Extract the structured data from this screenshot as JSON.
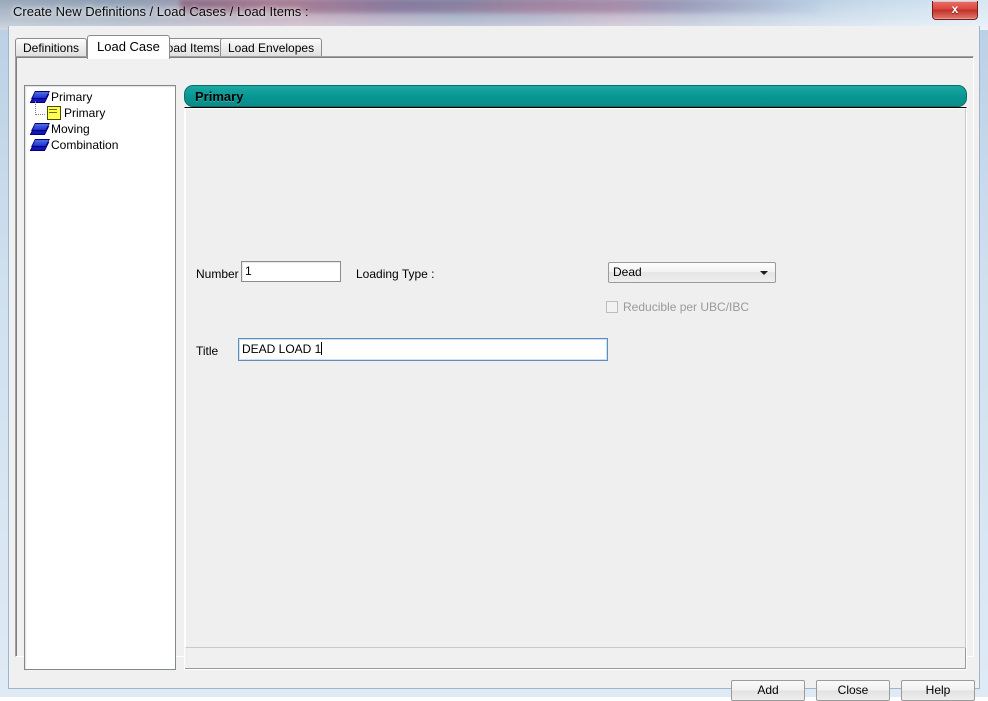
{
  "window": {
    "title": "Create New Definitions / Load Cases / Load Items :",
    "close_label": "x"
  },
  "tabs": [
    {
      "label": "Definitions",
      "active": false
    },
    {
      "label": "Load Case",
      "active": true
    },
    {
      "label": "Load Items",
      "active": false
    },
    {
      "label": "Load Envelopes",
      "active": false
    }
  ],
  "tree": {
    "items": [
      {
        "label": "Primary",
        "icon": "book-icon",
        "level": 0
      },
      {
        "label": "Primary",
        "icon": "note-icon",
        "level": 1
      },
      {
        "label": "Moving",
        "icon": "book-icon",
        "level": 0
      },
      {
        "label": "Combination",
        "icon": "book-icon",
        "level": 0
      }
    ]
  },
  "group": {
    "header": "Primary",
    "header_color": "#089693"
  },
  "form": {
    "number_label": "Number",
    "number_value": "1",
    "loading_type_label": "Loading Type :",
    "loading_type_value": "Dead",
    "loading_type_options": [
      "Dead"
    ],
    "reducible_label": "Reducible per UBC/IBC",
    "reducible_checked": false,
    "title_label": "Title",
    "title_value": "DEAD LOAD 1"
  },
  "footer": {
    "add_label": "Add",
    "close_label": "Close",
    "help_label": "Help"
  }
}
